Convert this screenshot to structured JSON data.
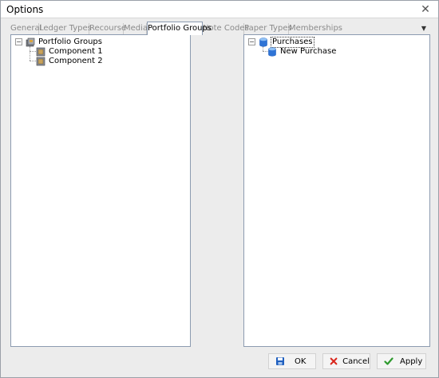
{
  "window": {
    "title": "Options",
    "close_glyph": "✕"
  },
  "tabs": [
    {
      "label": "General"
    },
    {
      "label": "Ledger Types"
    },
    {
      "label": "Recourse"
    },
    {
      "label": "Media"
    },
    {
      "label": "Portfolio Groups"
    },
    {
      "label": "Note Codes"
    },
    {
      "label": "Paper Types"
    },
    {
      "label": "Memberships"
    }
  ],
  "active_tab": "Portfolio Groups",
  "tab_dropdown_glyph": "▼",
  "left_tree": {
    "root": {
      "label": "Portfolio Groups",
      "expander": "−",
      "icon": "portfolio-group-icon"
    },
    "children": [
      {
        "label": "Component 1",
        "icon": "component-icon"
      },
      {
        "label": "Component 2",
        "icon": "component-icon"
      }
    ]
  },
  "right_tree": {
    "root": {
      "label": "Purchases",
      "expander": "−",
      "icon": "database-icon"
    },
    "children": [
      {
        "label": "New Purchase",
        "icon": "database-icon"
      }
    ]
  },
  "buttons": {
    "ok": {
      "label": "OK",
      "icon": "save-icon"
    },
    "cancel": {
      "label": "Cancel",
      "icon": "cancel-icon"
    },
    "apply": {
      "label": "Apply",
      "icon": "check-icon"
    }
  },
  "colors": {
    "accent_blue": "#1f5fbf",
    "cancel_red": "#d9261c",
    "apply_green": "#2e9a2e",
    "pane_border": "#8c9bb0"
  }
}
